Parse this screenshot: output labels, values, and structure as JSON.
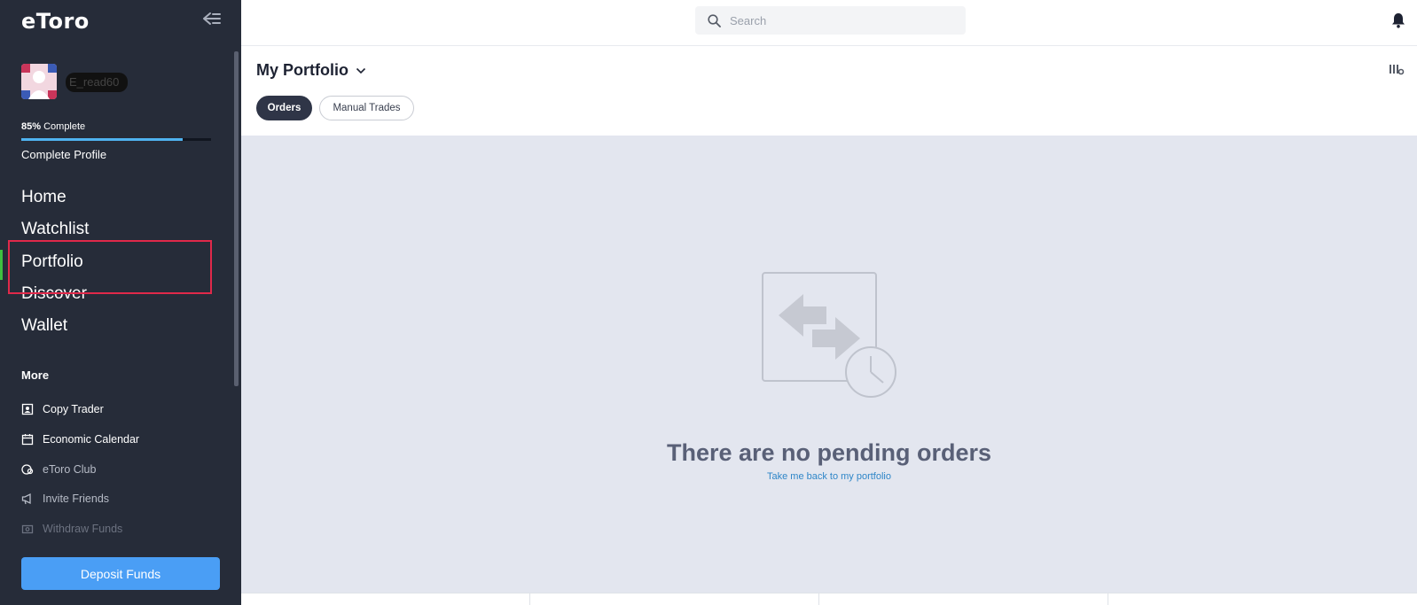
{
  "sidebar": {
    "logo": "eToro",
    "username": "E_read60",
    "profile": {
      "progress_percent": 85,
      "progress_pct_text": "85%",
      "progress_suffix": "Complete",
      "complete_profile_label": "Complete Profile"
    },
    "nav": [
      {
        "label": "Home"
      },
      {
        "label": "Watchlist"
      },
      {
        "label": "Portfolio",
        "active": true
      },
      {
        "label": "Discover"
      },
      {
        "label": "Wallet"
      }
    ],
    "more_label": "More",
    "more_items": [
      {
        "label": "Copy Trader",
        "icon": "copy-trader-icon"
      },
      {
        "label": "Economic Calendar",
        "icon": "calendar-icon"
      },
      {
        "label": "eToro Club",
        "icon": "club-icon"
      },
      {
        "label": "Invite Friends",
        "icon": "megaphone-icon"
      },
      {
        "label": "Withdraw Funds",
        "icon": "withdraw-icon"
      }
    ],
    "deposit_label": "Deposit Funds"
  },
  "topbar": {
    "search_placeholder": "Search"
  },
  "header": {
    "title": "My Portfolio",
    "tabs": [
      {
        "label": "Orders",
        "active": true
      },
      {
        "label": "Manual Trades",
        "active": false
      }
    ]
  },
  "empty_state": {
    "title": "There are no pending orders",
    "link": "Take me back to my portfolio"
  },
  "colors": {
    "sidebar_bg": "#262c39",
    "accent_blue": "#4a9ef5",
    "active_green": "#3fbf3f",
    "highlight_red": "#e0294a",
    "content_bg": "#e3e6ef"
  }
}
